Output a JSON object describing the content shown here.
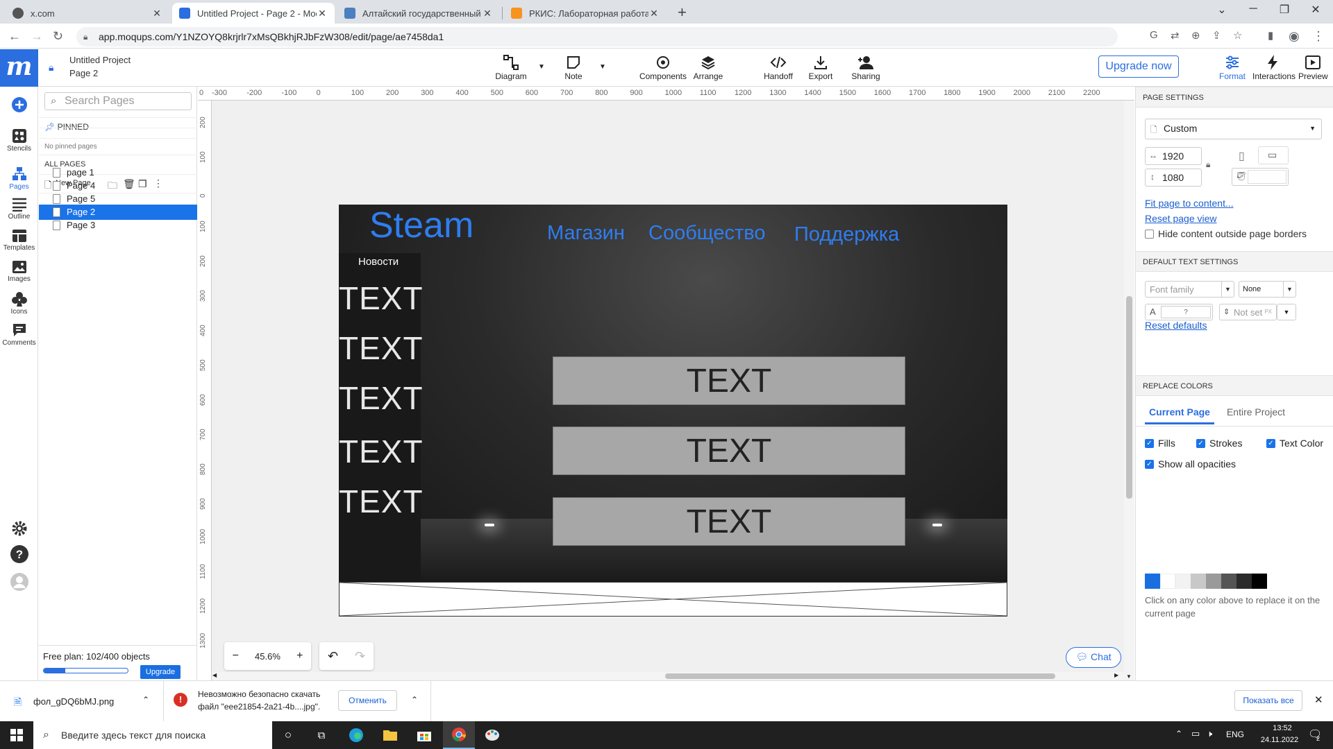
{
  "browser": {
    "tabs": [
      {
        "title": "x.com",
        "active": false
      },
      {
        "title": "Untitled Project - Page 2 - Moqu",
        "active": true
      },
      {
        "title": "Алтайский государственный ун",
        "active": false
      },
      {
        "title": "РКИС: Лабораторная работа №",
        "active": false
      }
    ],
    "url": "app.moqups.com/Y1NZOYQ8krjrlr7xMsQBkhjRJbFzW308/edit/page/ae7458da1"
  },
  "header": {
    "project_title": "Untitled Project",
    "page_title": "Page 2",
    "tools": {
      "diagram": "Diagram",
      "note": "Note",
      "components": "Components",
      "arrange": "Arrange",
      "handoff": "Handoff",
      "export": "Export",
      "sharing": "Sharing"
    },
    "upgrade_label": "Upgrade now",
    "right_tools": {
      "format": "Format",
      "interactions": "Interactions",
      "preview": "Preview"
    }
  },
  "rail": {
    "stencils": "Stencils",
    "pages": "Pages",
    "outline": "Outline",
    "templates": "Templates",
    "images": "Images",
    "icons": "Icons",
    "comments": "Comments"
  },
  "pages_panel": {
    "search_placeholder": "Search Pages",
    "pinned_label": "PINNED",
    "no_pinned": "No pinned pages",
    "all_pages_label": "ALL PAGES",
    "new_page_label": "New Page",
    "pages": [
      {
        "name": "page 1",
        "selected": false
      },
      {
        "name": "Page 4",
        "selected": false
      },
      {
        "name": "Page 5",
        "selected": false
      },
      {
        "name": "Page 2",
        "selected": true
      },
      {
        "name": "Page 3",
        "selected": false
      }
    ],
    "plan_text": "Free plan: 102/400 objects",
    "plan_fraction": 0.255,
    "upgrade_label": "Upgrade"
  },
  "canvas": {
    "ruler_top": [
      "0",
      "-300",
      "-200",
      "-100",
      "0",
      "100",
      "200",
      "300",
      "400",
      "500",
      "600",
      "700",
      "800",
      "900",
      "1000",
      "1100",
      "1200",
      "1300",
      "1400",
      "1500",
      "1600",
      "1700",
      "1800",
      "1900",
      "2000",
      "2100",
      "2200"
    ],
    "ruler_left": [
      "200",
      "100",
      "0",
      "100",
      "200",
      "300",
      "400",
      "500",
      "600",
      "700",
      "800",
      "900",
      "1000",
      "1100",
      "1200",
      "1300"
    ],
    "zoom_level": "45.6%",
    "chat_label": "Chat",
    "mockup": {
      "logo": "Steam",
      "nav": [
        "Магазин",
        "Сообщество",
        "Поддержка"
      ],
      "sidebar_title": "Новости",
      "sidebar_items": [
        "TEXT",
        "TEXT",
        "TEXT",
        "TEXT",
        "TEXT"
      ],
      "buttons": [
        "TEXT",
        "TEXT",
        "TEXT"
      ]
    }
  },
  "right_panel": {
    "page_settings_label": "PAGE SETTINGS",
    "page_size_preset": "Custom",
    "width": "1920",
    "height": "1080",
    "fit_link": "Fit page to content...",
    "reset_view_link": "Reset page view",
    "hide_content_label": "Hide content outside page borders",
    "default_text_label": "DEFAULT TEXT SETTINGS",
    "font_family_placeholder": "Font family",
    "font_style": "None",
    "font_size_value": "?",
    "line_height_placeholder": "Not set",
    "line_height_unit": "PX",
    "reset_defaults_link": "Reset defaults",
    "replace_colors_label": "REPLACE COLORS",
    "tab_current": "Current Page",
    "tab_entire": "Entire Project",
    "fills_label": "Fills",
    "strokes_label": "Strokes",
    "text_color_label": "Text Color",
    "show_opacities_label": "Show all opacities",
    "swatches": [
      "#1a6fe0",
      "#ffffff",
      "#f2f2f2",
      "#c8c8c8",
      "#9a9a9a",
      "#555555",
      "#2b2b2b",
      "#000000"
    ],
    "hint": "Click on any color above to replace it on the current page"
  },
  "downloads": {
    "file1": "фол_gDQ6bMJ.png",
    "warning_line1": "Невозможно безопасно скачать",
    "warning_line2": "файл \"eee21854-2a21-4b....jpg\".",
    "cancel_label": "Отменить",
    "show_all_label": "Показать все"
  },
  "taskbar": {
    "search_placeholder": "Введите здесь текст для поиска",
    "lang": "ENG",
    "time": "13:52",
    "date": "24.11.2022",
    "notif_count": "2"
  },
  "colors": {
    "accent": "#2a6ee0",
    "selected": "#1a73e8",
    "mock_link": "#2f7df0"
  }
}
